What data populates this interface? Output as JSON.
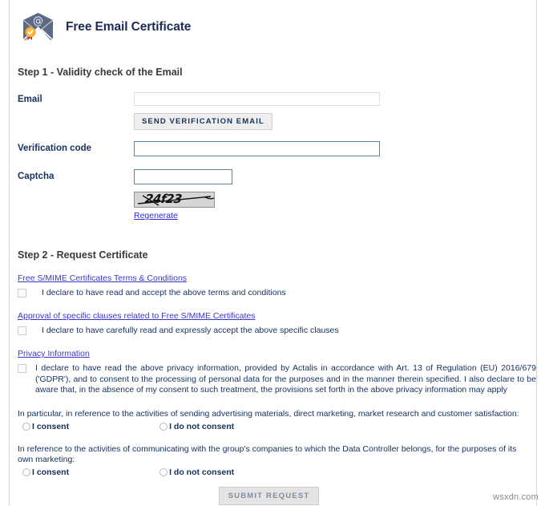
{
  "app": {
    "title": "Free Email Certificate",
    "icon": "email-certificate-icon"
  },
  "step1": {
    "heading": "Step 1 - Validity check of the Email",
    "email": {
      "label": "Email",
      "value": "",
      "placeholder": ""
    },
    "send_button": "SEND VERIFICATION EMAIL",
    "verification_code": {
      "label": "Verification code",
      "value": "",
      "placeholder": ""
    },
    "captcha": {
      "label": "Captcha",
      "value": "",
      "placeholder": "",
      "image_text": "24f23",
      "regenerate_link": "Regenerate"
    }
  },
  "step2": {
    "heading": "Step 2 - Request Certificate",
    "terms": {
      "link": "Free S/MIME Certificates Terms & Conditions",
      "checkbox_label": "I declare to have read and accept the above terms and conditions",
      "checked": false
    },
    "clauses": {
      "link": "Approval of specific clauses related to Free S/MIME Certificates",
      "checkbox_label": "I declare to have carefully read and expressly accept the above specific clauses",
      "checked": false
    },
    "privacy": {
      "link": "Privacy Information",
      "checkbox_label": "I declare to have read the above privacy information, provided by Actalis in accordance with Art. 13 of Regulation (EU) 2016/679 ('GDPR'), and to consent to the processing of personal data for the purposes and in the manner therein specified. I also declare to be aware that, in the absence of my consent to such treatment, the provisions set forth in the above privacy information may apply",
      "checked": false
    },
    "marketing_consent": {
      "question": "In particular, in reference to the activities of sending advertising materials, direct marketing, market research and customer satisfaction:",
      "option_yes": "I consent",
      "option_no": "I do not consent",
      "selected": ""
    },
    "group_consent": {
      "question": "In reference to the activities of communicating with the group's companies to which the Data Controller belongs, for the purposes of its own marketing:",
      "option_yes": "I consent",
      "option_no": "I do not consent",
      "selected": ""
    },
    "submit_button": "SUBMIT REQUEST"
  },
  "watermark": "wsxdn.com",
  "colors": {
    "title_navy": "#1b2a56",
    "label_navy": "#15305e",
    "link_blue": "#3838c8",
    "active_border": "#5b7fa6",
    "disabled_border": "#dededa"
  }
}
